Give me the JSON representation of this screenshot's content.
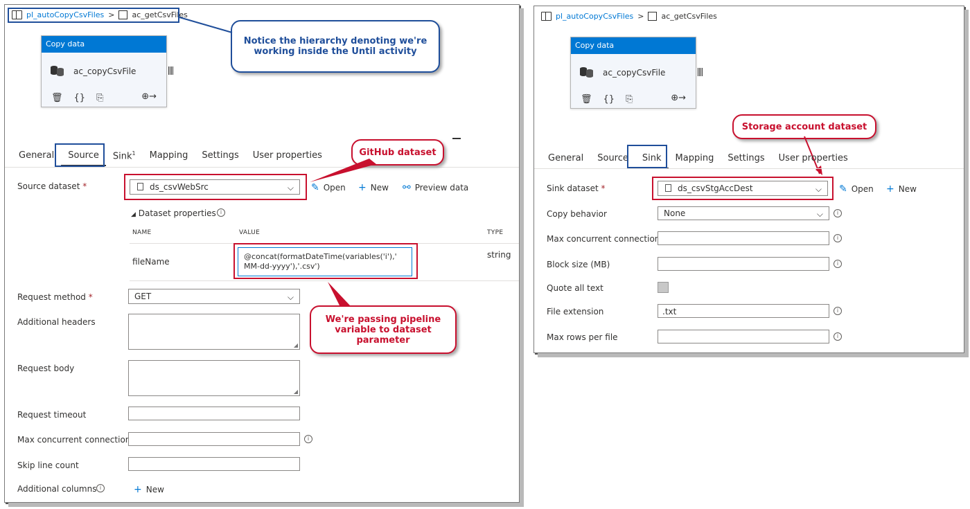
{
  "left": {
    "breadcrumb": {
      "pipeline": "pl_autoCopyCsvFiles",
      "separator": ">",
      "activity": "ac_getCsvFiles"
    },
    "activity_box": {
      "header": "Copy data",
      "name": "ac_copyCsvFile"
    },
    "tabs": {
      "general": "General",
      "source": "Source",
      "sink": "Sink",
      "sink_badge": "1",
      "mapping": "Mapping",
      "settings": "Settings",
      "user_properties": "User properties"
    },
    "source_dataset": {
      "label": "Source dataset",
      "required": "*",
      "value": "ds_csvWebSrc",
      "open": "Open",
      "new": "New",
      "preview": "Preview data"
    },
    "dataset_properties": {
      "title": "Dataset properties",
      "col_name": "NAME",
      "col_value": "VALUE",
      "col_type": "TYPE",
      "row": {
        "name": "fileName",
        "value_line1": "@concat(formatDateTime(variables('i'),'",
        "value_line2": "MM-dd-yyyy'),'.csv')",
        "type": "string"
      }
    },
    "request_method": {
      "label": "Request method",
      "required": "*",
      "value": "GET"
    },
    "additional_headers": {
      "label": "Additional headers"
    },
    "request_body": {
      "label": "Request body"
    },
    "request_timeout": {
      "label": "Request timeout"
    },
    "max_concurrent": {
      "label": "Max concurrent connections"
    },
    "skip_line_count": {
      "label": "Skip line count"
    },
    "additional_columns": {
      "label": "Additional columns",
      "new": "New"
    },
    "callouts": {
      "hierarchy": "Notice the hierarchy denoting we're working inside the Until activity",
      "github": "GitHub dataset",
      "passing": "We're passing pipeline variable to dataset parameter"
    }
  },
  "right": {
    "breadcrumb": {
      "pipeline": "pl_autoCopyCsvFiles",
      "separator": ">",
      "activity": "ac_getCsvFiles"
    },
    "activity_box": {
      "header": "Copy data",
      "name": "ac_copyCsvFile"
    },
    "tabs": {
      "general": "General",
      "source": "Source",
      "sink": "Sink",
      "mapping": "Mapping",
      "settings": "Settings",
      "user_properties": "User properties"
    },
    "sink_dataset": {
      "label": "Sink dataset",
      "required": "*",
      "value": "ds_csvStgAccDest",
      "open": "Open",
      "new": "New"
    },
    "copy_behavior": {
      "label": "Copy behavior",
      "value": "None"
    },
    "max_concurrent": {
      "label": "Max concurrent connections"
    },
    "block_size": {
      "label": "Block size (MB)"
    },
    "quote_all_text": {
      "label": "Quote all text"
    },
    "file_extension": {
      "label": "File extension",
      "value": ".txt"
    },
    "max_rows": {
      "label": "Max rows per file"
    },
    "callouts": {
      "storage": "Storage account dataset"
    }
  },
  "colors": {
    "accent": "#0078d4",
    "callout_red": "#c8102e",
    "callout_blue": "#1f4e9a"
  }
}
